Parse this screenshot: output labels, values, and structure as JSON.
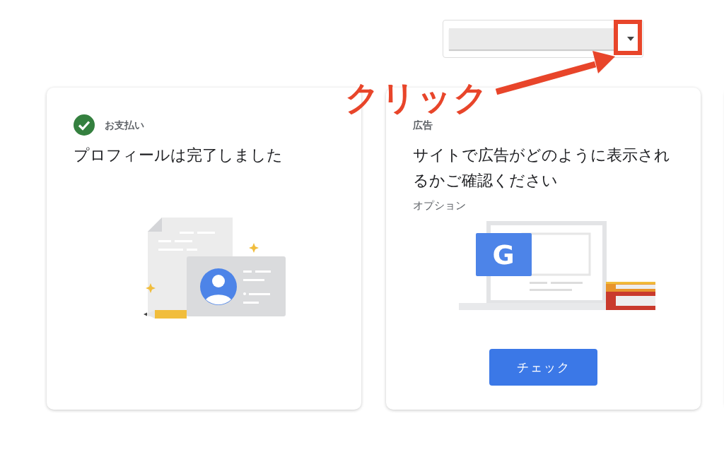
{
  "dropdown": {
    "open": false
  },
  "annotation": {
    "label": "クリック"
  },
  "cards": [
    {
      "kind": "status",
      "completed": true,
      "category": "お支払い",
      "title": "プロフィールは完了しました"
    },
    {
      "kind": "action",
      "category": "広告",
      "title": "サイトで広告がどのように表示されるかご確認ください",
      "subtitle": "オプション",
      "logo_letter": "G",
      "button": "チェック"
    }
  ]
}
